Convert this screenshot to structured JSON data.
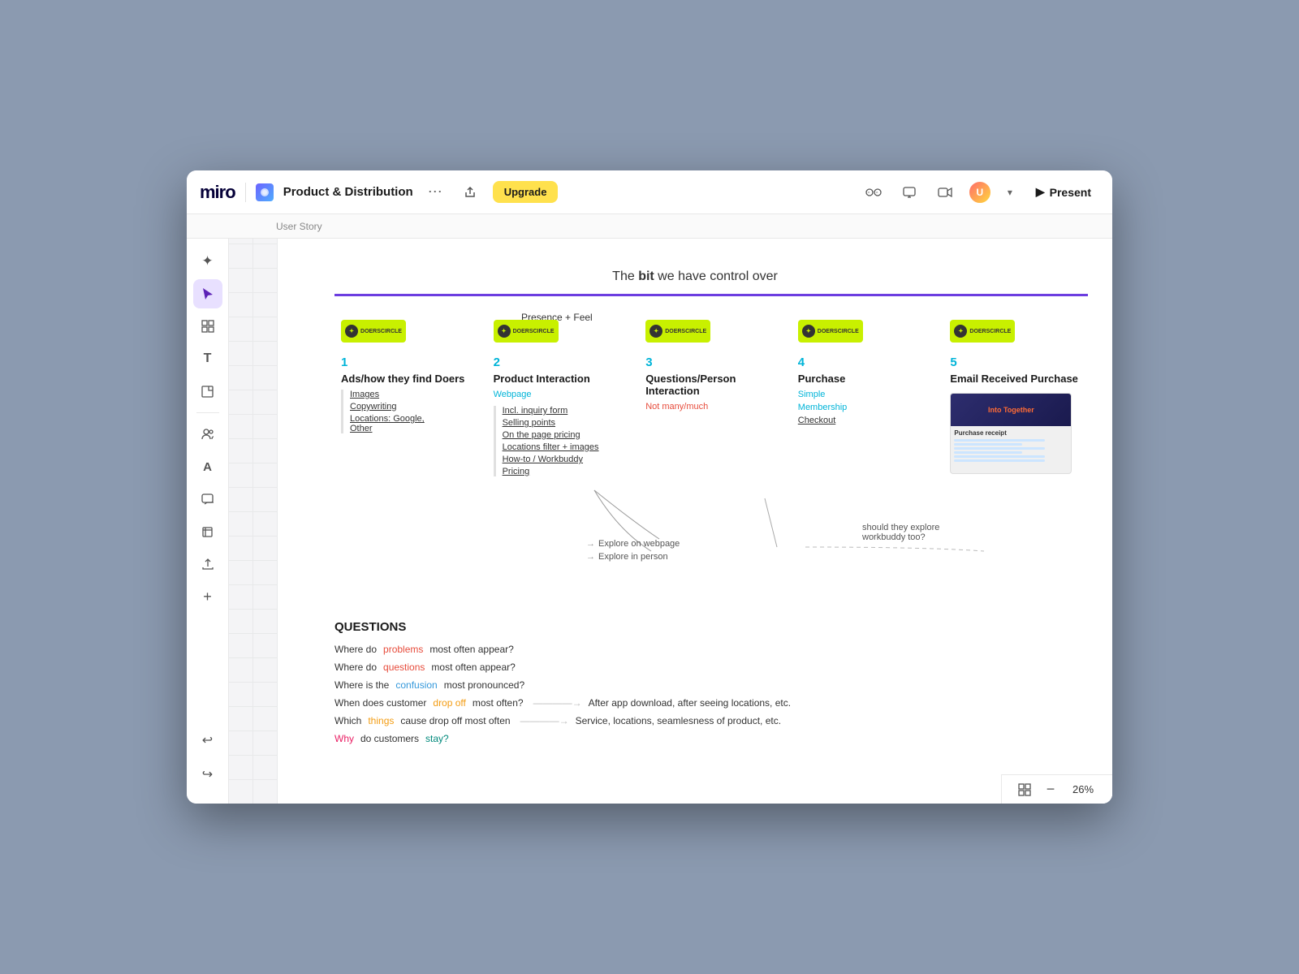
{
  "app": {
    "logo": "miro",
    "board_title": "Product & Distribution",
    "upgrade_label": "Upgrade",
    "present_label": "Present",
    "breadcrumb": "User Story"
  },
  "toolbar": {
    "tools": [
      {
        "name": "sparkle",
        "icon": "✦",
        "active": false
      },
      {
        "name": "cursor",
        "icon": "↖",
        "active": true
      },
      {
        "name": "grid",
        "icon": "⊞",
        "active": false
      },
      {
        "name": "text",
        "icon": "T",
        "active": false
      },
      {
        "name": "sticky",
        "icon": "⬜",
        "active": false
      },
      {
        "name": "people",
        "icon": "⚇",
        "active": false
      },
      {
        "name": "anchor",
        "icon": "A",
        "active": false
      },
      {
        "name": "comment",
        "icon": "💬",
        "active": false
      },
      {
        "name": "crop",
        "icon": "⊡",
        "active": false
      },
      {
        "name": "upload",
        "icon": "⬆",
        "active": false
      },
      {
        "name": "plus",
        "icon": "+",
        "active": false
      }
    ],
    "undo_icon": "↩",
    "redo_icon": "↪"
  },
  "canvas": {
    "top_label_prefix": "The ",
    "top_label_bold": "bit",
    "top_label_suffix": " we have control over",
    "presence_feel": "Presence + Feel",
    "columns": [
      {
        "num": "1",
        "title": "Ads/how they find Doers",
        "subtitle": "",
        "items": [
          "Images",
          "Copywriting",
          "Locations: Google, Other"
        ]
      },
      {
        "num": "2",
        "title": "Product Interaction",
        "subtitle": "Webpage",
        "items": [
          "Incl. inquiry form",
          "Selling points",
          "On the page pricing",
          "Locations filter + images",
          "How-to / Workbuddy",
          "Pricing"
        ]
      },
      {
        "num": "3",
        "title": "Questions/Person Interaction",
        "subtitle": "Not many/much",
        "items": []
      },
      {
        "num": "4",
        "title": "Purchase",
        "subtitle": "",
        "items": [
          "Simple",
          "Membership",
          "Checkout"
        ]
      },
      {
        "num": "5",
        "title": "Email Received Purchase",
        "subtitle": "",
        "items": []
      }
    ],
    "explore_items": [
      "Explore on webpage",
      "Explore in person"
    ],
    "explore_note": "should they explore workbuddy too?",
    "questions": {
      "title": "QUESTIONS",
      "rows": [
        {
          "prefix": "Where do ",
          "highlight": "problems",
          "highlight_color": "red",
          "suffix": " most often appear?",
          "answer": ""
        },
        {
          "prefix": "Where do ",
          "highlight": "questions",
          "highlight_color": "red",
          "suffix": " most often appear?",
          "answer": ""
        },
        {
          "prefix": "Where is the ",
          "highlight": "confusion",
          "highlight_color": "blue",
          "suffix": " most pronounced?",
          "answer": ""
        },
        {
          "prefix": "When does customer ",
          "highlight": "drop off",
          "highlight_color": "orange",
          "suffix": " most often?",
          "answer": "After app download, after seeing locations, etc."
        },
        {
          "prefix": "Which ",
          "highlight": "things",
          "highlight_color": "orange",
          "suffix": " cause drop off most often",
          "answer": "Service, locations, seamlesness of product, etc."
        },
        {
          "prefix": "Why",
          "prefix_color": "pink",
          "highlight": "",
          "suffix": " do customers ",
          "stay": "stay?",
          "stay_color": "teal",
          "answer": ""
        }
      ]
    }
  },
  "bottom_bar": {
    "zoom": "26%"
  }
}
